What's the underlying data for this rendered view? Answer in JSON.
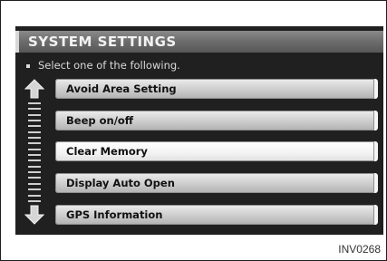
{
  "header": {
    "title": "SYSTEM SETTINGS"
  },
  "subtitle": "Select one of the following.",
  "menu": {
    "items": [
      {
        "label": "Avoid Area Setting",
        "selected": false
      },
      {
        "label": "Beep on/off",
        "selected": false
      },
      {
        "label": "Clear Memory",
        "selected": true
      },
      {
        "label": "Display Auto Open",
        "selected": false
      },
      {
        "label": "GPS Information",
        "selected": false
      }
    ]
  },
  "icons": {
    "scroll_up": "arrow-up-icon",
    "scroll_down": "arrow-down-icon"
  },
  "figure_code": "INV0268"
}
